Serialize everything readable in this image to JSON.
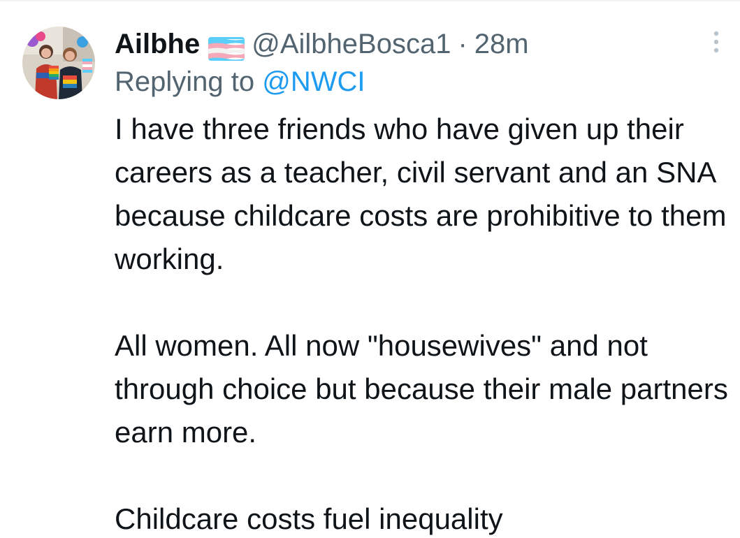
{
  "tweet": {
    "display_name": "Ailbhe",
    "flag_icon": "transgender-flag-icon",
    "flag_colors": [
      "#5bcefa",
      "#f5a9b8",
      "#ffffff"
    ],
    "handle": "@AilbheBosca1",
    "separator": "·",
    "time": "28m",
    "replying_to_label": "Replying to",
    "replying_to_mention": "@NWCI",
    "more_icon": "more-options-icon",
    "paragraphs": [
      "I have three friends who have given up their careers as a teacher, civil servant and an SNA because childcare costs are prohibitive to them working.",
      "All women. All now \"housewives\" and not through choice but because their male partners earn more.",
      "Childcare costs fuel inequality"
    ]
  },
  "colors": {
    "text_primary": "#0f1419",
    "text_secondary": "#536471",
    "link": "#1d9bf0",
    "background": "#ffffff"
  }
}
